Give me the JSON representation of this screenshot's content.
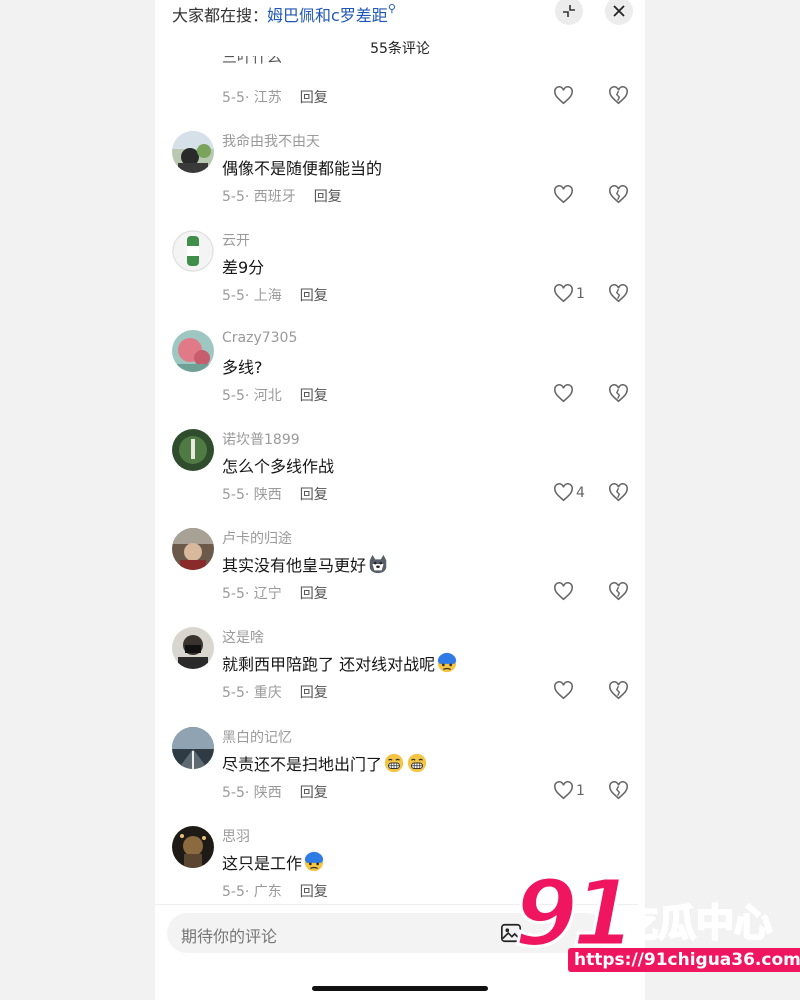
{
  "search": {
    "prefix": "大家都在搜：",
    "term": "姆巴佩和c罗差距",
    "icon": "search-icon"
  },
  "header": {
    "title": "55条评论"
  },
  "partial_comment": {
    "text": "三叶什么",
    "date": "5-5",
    "location": "江苏",
    "reply_label": "回复",
    "likes": ""
  },
  "comments": [
    {
      "username": "我命由我不由天",
      "text": "偶像不是随便都能当的",
      "date": "5-5",
      "location": "西班牙",
      "reply_label": "回复",
      "likes": ""
    },
    {
      "username": "云开",
      "text": "差9分",
      "date": "5-5",
      "location": "上海",
      "reply_label": "回复",
      "likes": "1"
    },
    {
      "username": "Crazy7305",
      "text": "多线?",
      "date": "5-5",
      "location": "河北",
      "reply_label": "回复",
      "likes": ""
    },
    {
      "username": "诺坎普1899",
      "text": "怎么个多线作战",
      "date": "5-5",
      "location": "陕西",
      "reply_label": "回复",
      "likes": "4"
    },
    {
      "username": "卢卡的归途",
      "text": "其实没有他皇马更好",
      "date": "5-5",
      "location": "辽宁",
      "reply_label": "回复",
      "likes": ""
    },
    {
      "username": "这是啥",
      "text": "就剩西甲陪跑了 还对线对战呢",
      "date": "5-5",
      "location": "重庆",
      "reply_label": "回复",
      "likes": ""
    },
    {
      "username": "黑白的记忆",
      "text": "尽责还不是扫地出门了",
      "date": "5-5",
      "location": "陕西",
      "reply_label": "回复",
      "likes": "1"
    },
    {
      "username": "思羽",
      "text": "这只是工作",
      "date": "5-5",
      "location": "广东",
      "reply_label": "回复",
      "likes": ""
    }
  ],
  "input": {
    "placeholder": "期待你的评论"
  },
  "watermark": {
    "number": "91",
    "name": "吃瓜中心",
    "url": "https://91chigua36.com"
  },
  "colors": {
    "accent_link": "#1f57b8",
    "watermark": "#f0155f"
  }
}
